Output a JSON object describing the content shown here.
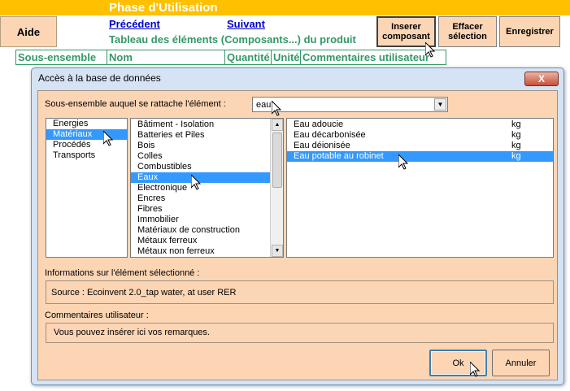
{
  "sheet": {
    "title": "Phase d'Utilisation",
    "help_button": "Aide",
    "prev_link": "Précédent",
    "next_link": "Suivant",
    "heading": "Tableau des éléments (Composants...) du produit",
    "buttons": {
      "insert": "Inserer composant",
      "clear": "Effacer sélection",
      "save": "Enregistrer"
    },
    "columns": [
      "Sous-ensemble",
      "Nom",
      "Quantité",
      "Unité",
      "Commentaires utilisateur"
    ]
  },
  "dialog": {
    "title": "Accès à la base de données",
    "close_label": "X",
    "subset_label": "Sous-ensemble auquel se rattache l'élément :",
    "subset_value": "eau",
    "categories": [
      "Energies",
      "Matériaux",
      "Procédés",
      "Transports"
    ],
    "categories_selected": 1,
    "subcategories": [
      "Bâtiment - Isolation",
      "Batteries et Piles",
      "Bois",
      "Colles",
      "Combustibles",
      "Eaux",
      "Electronique",
      "Encres",
      "Fibres",
      "Immobilier",
      "Matériaux de construction",
      "Métaux ferreux",
      "Métaux non ferreux"
    ],
    "subcategories_selected": 5,
    "elements": [
      {
        "name": "Eau adoucie",
        "unit": "kg"
      },
      {
        "name": "Eau décarbonisée",
        "unit": "kg"
      },
      {
        "name": "Eau déionisée",
        "unit": "kg"
      },
      {
        "name": "Eau potable au robinet",
        "unit": "kg"
      }
    ],
    "elements_selected": 3,
    "info_label": "Informations sur l'élément sélectionné :",
    "info_value": "Source : Ecoinvent 2.0_tap water, at user RER",
    "comments_label": "Commentaires utilisateur :",
    "comments_value": "Vous pouvez insérer ici vos remarques.",
    "ok_label": "Ok",
    "cancel_label": "Annuler"
  },
  "colors": {
    "banner": "#ffc000",
    "panel": "#fcd5b4",
    "selection": "#3399ff",
    "heading": "#339966",
    "link": "#0000cc"
  }
}
